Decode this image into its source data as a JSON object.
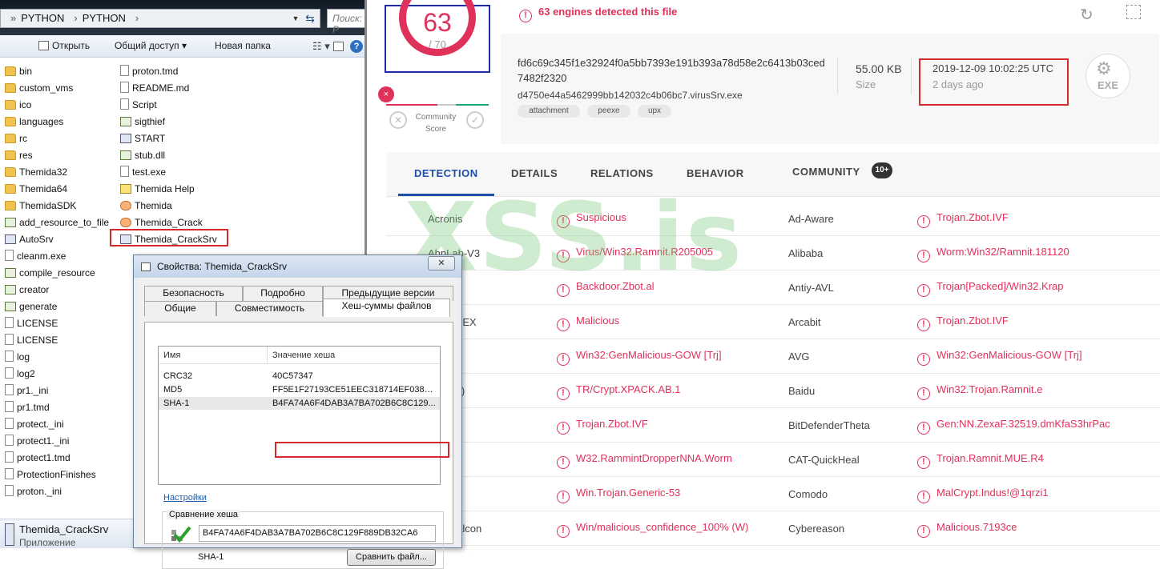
{
  "explorer": {
    "breadcrumb": [
      "PYTHON",
      "PYTHON"
    ],
    "search_placeholder": "Поиск: Р",
    "toolbar": {
      "open": "Открыть",
      "share": "Общий доступ",
      "new_folder": "Новая папка"
    },
    "col1": [
      {
        "name": "bin",
        "icon": "folder-icon"
      },
      {
        "name": "custom_vms",
        "icon": "folder-icon"
      },
      {
        "name": "ico",
        "icon": "folder-icon"
      },
      {
        "name": "languages",
        "icon": "folder-icon"
      },
      {
        "name": "rc",
        "icon": "folder-icon"
      },
      {
        "name": "res",
        "icon": "folder-icon"
      },
      {
        "name": "Themida32",
        "icon": "folder-icon"
      },
      {
        "name": "Themida64",
        "icon": "folder-icon"
      },
      {
        "name": "ThemidaSDK",
        "icon": "folder-icon"
      },
      {
        "name": "add_resource_to_file",
        "icon": "script-icon"
      },
      {
        "name": "AutoSrv",
        "icon": "app-icon"
      },
      {
        "name": "cleanm.exe",
        "icon": "document-icon"
      },
      {
        "name": "compile_resource",
        "icon": "script-icon"
      },
      {
        "name": "creator",
        "icon": "script-icon"
      },
      {
        "name": "generate",
        "icon": "script-icon"
      },
      {
        "name": "LICENSE",
        "icon": "document-icon"
      },
      {
        "name": "LICENSE",
        "icon": "document-icon"
      },
      {
        "name": "log",
        "icon": "document-icon"
      },
      {
        "name": "log2",
        "icon": "document-icon"
      },
      {
        "name": "pr1._ini",
        "icon": "document-icon"
      },
      {
        "name": "pr1.tmd",
        "icon": "document-icon"
      },
      {
        "name": "protect._ini",
        "icon": "document-icon"
      },
      {
        "name": "protect1._ini",
        "icon": "document-icon"
      },
      {
        "name": "protect1.tmd",
        "icon": "document-icon"
      },
      {
        "name": "ProtectionFinishes",
        "icon": "document-icon"
      },
      {
        "name": "proton._ini",
        "icon": "document-icon"
      }
    ],
    "col2": [
      {
        "name": "proton.tmd",
        "icon": "document-icon"
      },
      {
        "name": "README.md",
        "icon": "document-icon"
      },
      {
        "name": "Script",
        "icon": "document-icon"
      },
      {
        "name": "sigthief",
        "icon": "script-icon"
      },
      {
        "name": "START",
        "icon": "app-icon"
      },
      {
        "name": "stub.dll",
        "icon": "script-icon"
      },
      {
        "name": "test.exe",
        "icon": "document-icon"
      },
      {
        "name": "Themida Help",
        "icon": "help-icon"
      },
      {
        "name": "Themida",
        "icon": "theme-icon"
      },
      {
        "name": "Themida_Crack",
        "icon": "theme-icon"
      },
      {
        "name": "Themida_CrackSrv",
        "icon": "app-icon"
      }
    ],
    "details": {
      "name": "Themida_CrackSrv",
      "type": "Приложение"
    }
  },
  "dialog": {
    "title": "Свойства: Themida_CrackSrv",
    "close": "✕",
    "tabs_row1": [
      "Безопасность",
      "Подробно",
      "Предыдущие версии"
    ],
    "tabs_row2": [
      "Общие",
      "Совместимость",
      "Хеш-суммы файлов"
    ],
    "columns": [
      "Имя",
      "Значение хеша"
    ],
    "hashes": [
      {
        "name": "CRC32",
        "value": "40C57347"
      },
      {
        "name": "MD5",
        "value": "FF5E1F27193CE51EEC318714EF038B..."
      },
      {
        "name": "SHA-1",
        "value": "B4FA74A6F4DAB3A7BA702B6C8C129..."
      }
    ],
    "settings_link": "Настройки",
    "compare_legend": "Сравнение хеша",
    "compare_value": "B4FA74A6F4DAB3A7BA702B6C8C129F889DB32CA6",
    "compare_algo": "SHA-1",
    "compare_button": "Сравнить файл..."
  },
  "vt": {
    "score": "63",
    "total": "/ 70",
    "community_label": "Community Score",
    "banner": "63 engines detected this file",
    "sha256": "fd6c69c345f1e32924f0a5bb7393e191b393a78d58e2c6413b03ced7482f2320",
    "filename": "d4750e44a5462999bb142032c4b06bc7.virusSrv.exe",
    "tags": [
      "attachment",
      "peexe",
      "upx"
    ],
    "size": "55.00 KB",
    "size_label": "Size",
    "date": "2019-12-09 10:02:25 UTC",
    "date_ago": "2 days ago",
    "filetype": "EXE",
    "tabs": [
      "DETECTION",
      "DETAILS",
      "RELATIONS",
      "BEHAVIOR",
      "COMMUNITY"
    ],
    "community_count": "10+",
    "results": [
      [
        "Acronis",
        "Suspicious",
        "Ad-Aware",
        "Trojan.Zbot.IVF"
      ],
      [
        "AhnLab-V3",
        "Virus/Win32.Ramnit.R205005",
        "Alibaba",
        "Worm:Win32/Ramnit.181120"
      ],
      [
        "",
        "Backdoor.Zbot.al",
        "Antiy-AVL",
        "Trojan[Packed]/Win32.Krap"
      ],
      [
        "Age APEX",
        "Malicious",
        "Arcabit",
        "Trojan.Zbot.IVF"
      ],
      [
        "",
        "Win32:GenMalicious-GOW [Trj]",
        "AVG",
        "Win32:GenMalicious-GOW [Trj]"
      ],
      [
        "o cloud)",
        "TR/Crypt.XPACK.AB.1",
        "Baidu",
        "Win32.Trojan.Ramnit.e"
      ],
      [
        "nder",
        "Trojan.Zbot.IVF",
        "BitDefenderTheta",
        "Gen:NN.ZexaF.32519.dmKfaS3hrPac"
      ],
      [
        "",
        "W32.RammintDropperNNA.Worm",
        "CAT-QuickHeal",
        "Trojan.Ramnit.MUE.R4"
      ],
      [
        "y",
        "Win.Trojan.Generic-53",
        "Comodo",
        "MalCrypt.Indus!@1qrzi1"
      ],
      [
        "trike Falcon",
        "Win/malicious_confidence_100% (W)",
        "Cybereason",
        "Malicious.7193ce"
      ]
    ],
    "watermark": "XSS.is"
  }
}
